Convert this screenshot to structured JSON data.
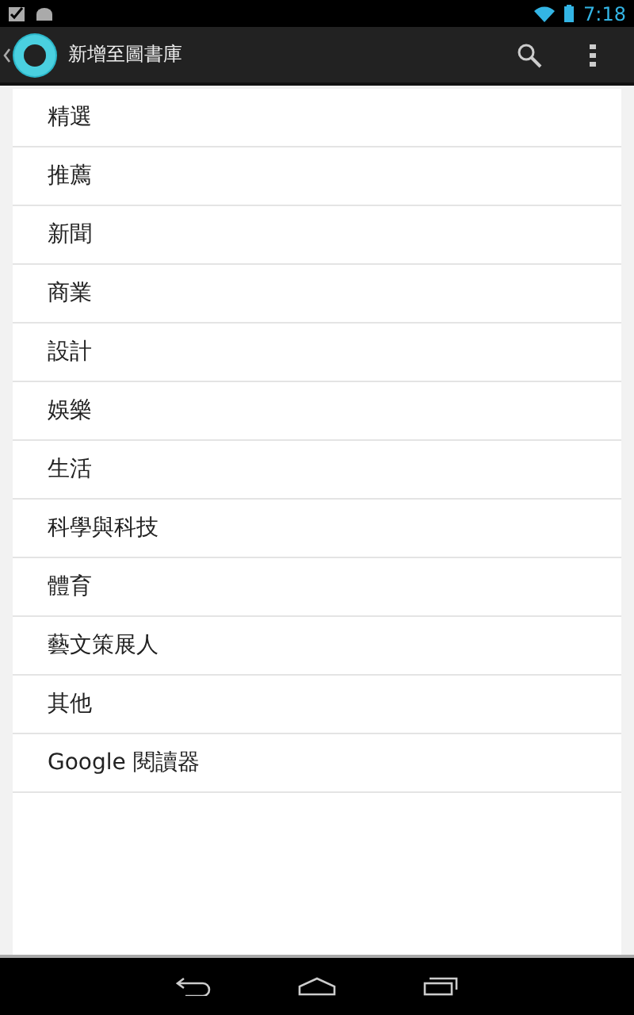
{
  "status_bar": {
    "time": "7:18"
  },
  "action_bar": {
    "title": "新增至圖書庫"
  },
  "categories": [
    {
      "label": "精選"
    },
    {
      "label": "推薦"
    },
    {
      "label": "新聞"
    },
    {
      "label": "商業"
    },
    {
      "label": "設計"
    },
    {
      "label": "娛樂"
    },
    {
      "label": "生活"
    },
    {
      "label": "科學與科技"
    },
    {
      "label": "體育"
    },
    {
      "label": "藝文策展人"
    },
    {
      "label": "其他"
    },
    {
      "label": "Google 閱讀器"
    }
  ]
}
